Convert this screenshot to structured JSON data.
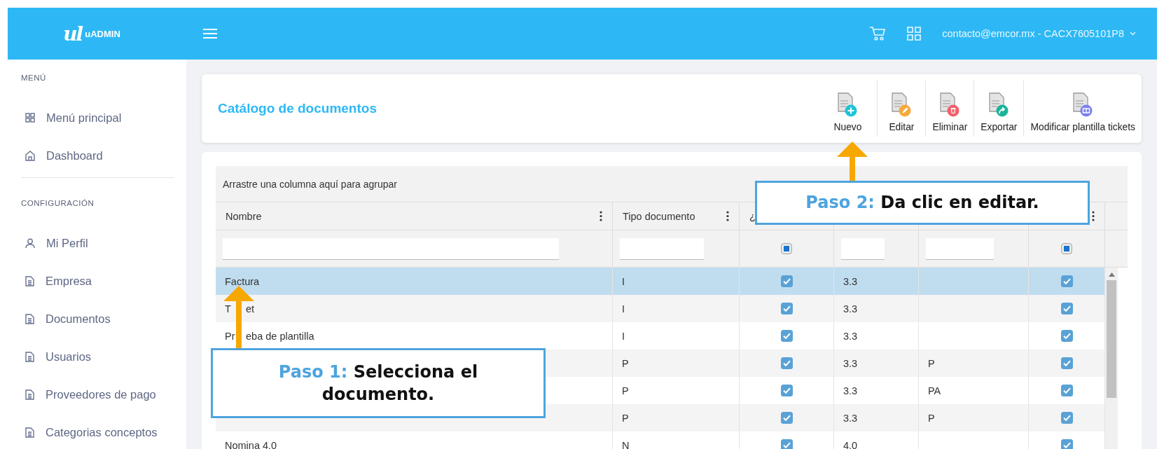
{
  "header": {
    "logo_mark": "ul",
    "logo_text": "uADMIN",
    "account": "contacto@emcor.mx - CACX7605101P8"
  },
  "sidebar": {
    "sections": [
      {
        "heading": "MENÚ",
        "items": [
          {
            "label": "Menú principal",
            "kind": "grid"
          },
          {
            "label": "Dashboard",
            "kind": "home"
          }
        ]
      },
      {
        "heading": "CONFIGURACIÓN",
        "items": [
          {
            "label": "Mi Perfil",
            "kind": "user"
          },
          {
            "label": "Empresa",
            "kind": "doc"
          },
          {
            "label": "Documentos",
            "kind": "doc"
          },
          {
            "label": "Usuarios",
            "kind": "doc"
          },
          {
            "label": "Proveedores de pago",
            "kind": "doc"
          },
          {
            "label": "Categorias conceptos",
            "kind": "doc"
          }
        ]
      }
    ]
  },
  "toolbar": {
    "title": "Catálogo de documentos",
    "buttons": [
      {
        "label": "Nuevo",
        "kind": "add",
        "color": "#1ec3d9"
      },
      {
        "label": "Editar",
        "kind": "edit",
        "color": "#f7a93b"
      },
      {
        "label": "Eliminar",
        "kind": "delete",
        "color": "#f2606a"
      },
      {
        "label": "Exportar",
        "kind": "export",
        "color": "#1bb39a"
      },
      {
        "label": "Modificar plantilla tickets",
        "kind": "ticket",
        "color": "#7b7ff0"
      }
    ]
  },
  "table": {
    "group_hint": "Arrastre una columna aquí para agrupar",
    "columns": [
      {
        "label": "Nombre",
        "menu": true
      },
      {
        "label": "Tipo documento",
        "menu": true
      },
      {
        "label": "¿"
      },
      {},
      {},
      {
        "menu": true
      }
    ],
    "filters": [
      {
        "kind": "text"
      },
      {
        "kind": "text"
      },
      {
        "kind": "check",
        "indeterminate": true
      },
      {
        "kind": "text"
      },
      {
        "kind": "text"
      },
      {
        "kind": "check",
        "indeterminate": true
      }
    ],
    "rows": [
      {
        "name": "Factura",
        "type": "I",
        "column_3": true,
        "column_4": "3.3",
        "column_6": true,
        "selected": true
      },
      {
        "name_parts": [
          "T",
          "et"
        ],
        "type": "I",
        "column_3": true,
        "column_4": "3.3",
        "column_6": true,
        "selected": false
      },
      {
        "name_parts": [
          "Pr",
          "eba de plantilla"
        ],
        "type": "I",
        "column_3": true,
        "column_4": "3.3",
        "column_6": true,
        "selected": false
      },
      {
        "type": "P",
        "column_3": true,
        "column_4": "3.3",
        "column_5": "P",
        "column_6": true,
        "selected": false
      },
      {
        "type": "P",
        "column_3": true,
        "column_4": "3.3",
        "column_5": "PA",
        "column_6": true,
        "selected": false
      },
      {
        "type": "P",
        "column_3": true,
        "column_4": "3.3",
        "column_5": "P",
        "column_6": true,
        "selected": false
      },
      {
        "name": "Nomina 4.0",
        "type": "N",
        "column_3": true,
        "column_4": "4.0",
        "column_6": true,
        "selected": false
      }
    ]
  },
  "callouts": [
    {
      "step": "Paso 2:",
      "text": "Da clic en editar."
    },
    {
      "step": "Paso 1:",
      "text": "Selecciona el documento."
    }
  ]
}
